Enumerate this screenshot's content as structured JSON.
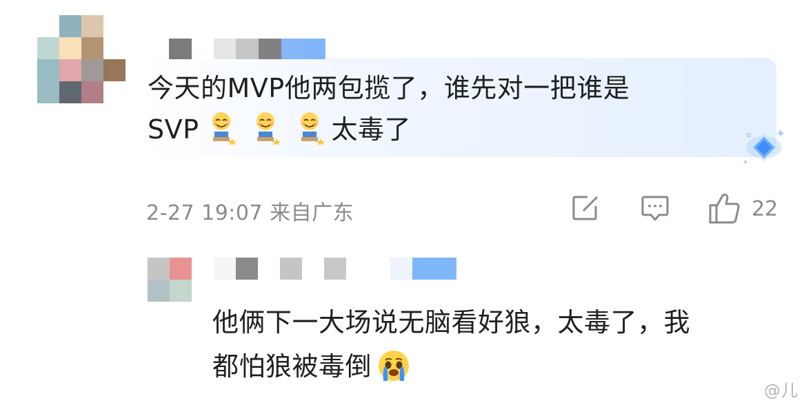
{
  "comment": {
    "text_line1": "今天的MVP他两包揽了，谁先对一把谁是",
    "text_line2_prefix": "SVP",
    "text_line2_suffix": "太毒了",
    "emojis": [
      "sly-kneeling-emoji",
      "sly-kneeling-emoji",
      "sly-kneeling-emoji"
    ],
    "timestamp": "2-27 19:07",
    "location": "来自广东",
    "likes": "22",
    "avatar_colors": [
      "#ffffff",
      "#8fb3bc",
      "#dcc7ae",
      "#ffffff",
      "#bfd7d3",
      "#fae0b6",
      "#b49373",
      "#ffffff",
      "#97bcc4",
      "#e2a6ad",
      "#9e9a97",
      "#967757",
      "#9cbbc2",
      "#5f6870",
      "#b17f87",
      "#ffffff"
    ],
    "name_colors": [
      "#7b7b7b",
      "#ffffff",
      "#e6e6e6",
      "#c6c6c6",
      "#818181",
      "#85b7f8",
      "#7fb6fa"
    ]
  },
  "reply": {
    "text_line1": "他俩下一大场说无脑看好狼，太毒了，我",
    "text_line2": "都怕狼被毒倒",
    "emoji": "crying-emoji",
    "avatar_colors": [
      "#c7c4c4",
      "#e99294",
      "#b2c0c7",
      "#c3d7cd"
    ],
    "name_colors": [
      "#f5f5f5",
      "#8a8a8a",
      "#ffffff",
      "#c5c5c5",
      "#ffffff",
      "#c8c8c8",
      "#ffffff",
      "#ffffff",
      "#eef4fe",
      "#7fb6fa",
      "#7fb6fa"
    ]
  },
  "watermark": "@儿",
  "colors": {
    "text": "#1f1f1f",
    "meta": "#8a8a8a",
    "accent_blue": "#7fb6fa"
  }
}
